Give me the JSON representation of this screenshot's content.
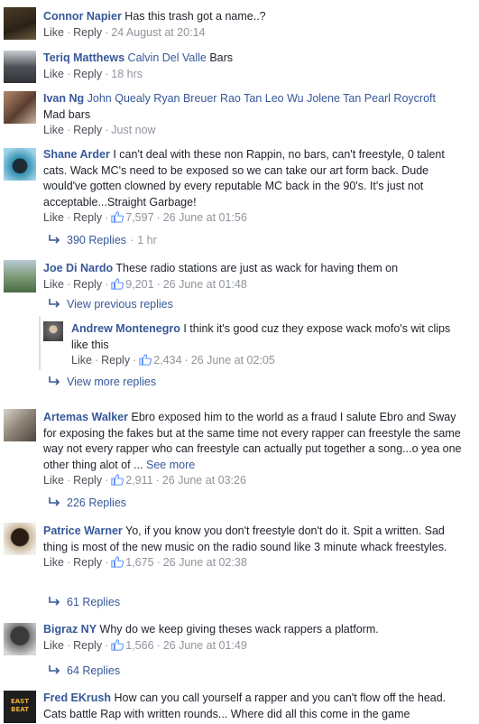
{
  "comments": [
    {
      "name": "Connor Napier",
      "text": "Has this trash got a name..?",
      "like": "Like",
      "reply": "Reply",
      "time": "24 August at 20:14",
      "avatar_color": "#3b3222"
    },
    {
      "name": "Teriq Matthews",
      "tags": "Calvin Del Valle",
      "text": "Bars",
      "like": "Like",
      "reply": "Reply",
      "time": "18 hrs",
      "avatar_color": "#5a6068"
    },
    {
      "name": "Ivan Ng",
      "tags": "John Quealy Ryan Breuer Rao Tan Leo Wu Jolene Tan Pearl Roycroft",
      "text": "Mad bars",
      "like": "Like",
      "reply": "Reply",
      "time": "Just now",
      "avatar_color": "#6a4a3c"
    },
    {
      "name": "Shane Arder",
      "text": "I can't deal with these non Rappin, no bars, can't freestyle, 0 talent cats. Wack MC's need to be exposed so we can take our art form back. Dude would've gotten clowned by every reputable MC back in the 90's. It's just not acceptable...Straight Garbage!",
      "like": "Like",
      "reply": "Reply",
      "likes_count": "7,597",
      "time": "26 June at 01:56",
      "replies": "390 Replies",
      "replies_time": "1 hr",
      "avatar_color": "#2a7b9a"
    },
    {
      "name": "Joe Di Nardo",
      "text": "These radio stations are just as wack for having them on",
      "like": "Like",
      "reply": "Reply",
      "likes_count": "9,201",
      "time": "26 June at 01:48",
      "view_previous": "View previous replies",
      "view_more": "View more replies",
      "avatar_color": "#6f8f6a"
    },
    {
      "name": "Artemas Walker",
      "text": "Ebro exposed him to the world as a fraud I salute Ebro and Sway for exposing the fakes but at the same time not every rapper can freestyle the same way not every rapper who can freestyle can actually put together a song...o yea one other thing alot of ...",
      "see_more": "See more",
      "like": "Like",
      "reply": "Reply",
      "likes_count": "2,911",
      "time": "26 June at 03:26",
      "replies": "226 Replies",
      "avatar_color": "#8c8276"
    },
    {
      "name": "Patrice Warner",
      "text": "Yo, if you know you don't freestyle don't do it. Spit a written. Sad thing is most of the new music on the radio sound like 3 minute whack freestyles.",
      "like": "Like",
      "reply": "Reply",
      "likes_count": "1,675",
      "time": "26 June at 02:38",
      "replies": "61 Replies",
      "avatar_color": "#3a2a1e"
    },
    {
      "name": "Bigraz NY",
      "text": "Why do we keep giving theses wack rappers a platform.",
      "like": "Like",
      "reply": "Reply",
      "likes_count": "1,566",
      "time": "26 June at 01:49",
      "replies": "64 Replies",
      "avatar_color": "#4a4a4a"
    },
    {
      "name": "Fred EKrush",
      "text": "How can you call yourself a rapper and you can't flow off the head. Cats battle Rap with written rounds... Where did all this come in the game",
      "avatar_color": "#2b2b2b",
      "avatar_text": "EAST BEAT"
    }
  ],
  "nested_reply": {
    "name": "Andrew Montenegro",
    "text": "I think it's good cuz they expose wack mofo's wit clips like this",
    "like": "Like",
    "reply": "Reply",
    "likes_count": "2,434",
    "time": "26 June at 02:05",
    "avatar_color": "#6b6b6b"
  },
  "colors": {
    "link": "#365899",
    "meta": "#90949c",
    "text": "#1d2129",
    "like_icon": "#5890ff"
  }
}
